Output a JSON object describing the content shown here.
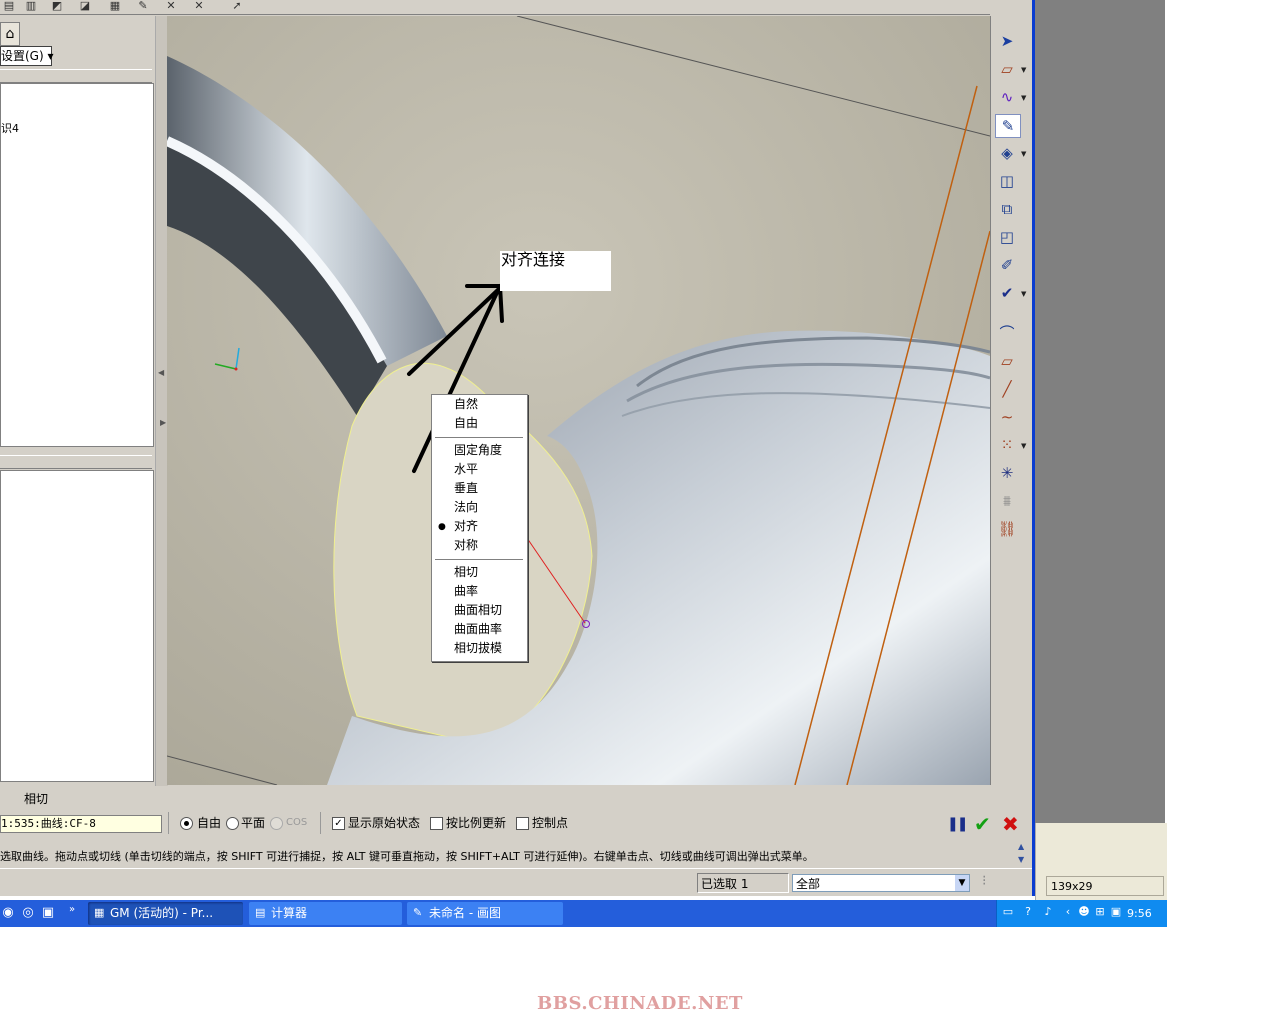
{
  "left_panel": {
    "settings_dropdown": "设置(G)",
    "tree_item": "识4"
  },
  "viewport": {
    "note_label": "对齐连接",
    "context_menu": {
      "group1": [
        "自然",
        "自由"
      ],
      "group2": [
        "固定角度",
        "水平",
        "垂直",
        "法向",
        "对齐",
        "对称"
      ],
      "group3": [
        "相切",
        "曲率",
        "曲面相切",
        "曲面曲率",
        "相切拔模"
      ],
      "selected": "对齐"
    }
  },
  "dashboard": {
    "tab_label": "相切",
    "curve_field": "1:535:曲线:CF-8",
    "radio_free": "自由",
    "radio_plane": "平面",
    "radio_cos": "COS",
    "radio_selected": "自由",
    "chk_show_original": "显示原始状态",
    "chk_show_original_checked": true,
    "chk_scale_update": "按比例更新",
    "chk_scale_update_checked": false,
    "chk_control_points": "控制点",
    "chk_control_points_checked": false
  },
  "message": "选取曲线。拖动点或切线 (单击切线的端点，按 SHIFT 可进行捕捉，按 ALT 键可垂直拖动，按 SHIFT+ALT 可进行延伸)。右键单击点、切线或曲线可调出弹出式菜单。",
  "status_bar": {
    "selected_count": "已选取 1",
    "filter_value": "全部",
    "paint_size": "139x29"
  },
  "taskbar": {
    "tasks": [
      {
        "label": "GM (活动的) - Pr...",
        "icon": "pro-e-icon",
        "active": true
      },
      {
        "label": "计算器",
        "icon": "calculator-icon",
        "active": false
      },
      {
        "label": "未命名 - 画图",
        "icon": "paint-icon",
        "active": false
      }
    ],
    "clock": "9:56"
  },
  "watermark": "BBS.CHINADE.NET",
  "colors": {
    "viewport_bg": "#b7b3a6",
    "taskbar": "#245edb",
    "window_border": "#0a3cd0",
    "ok_green": "#13a013",
    "cancel_red": "#d01010"
  }
}
